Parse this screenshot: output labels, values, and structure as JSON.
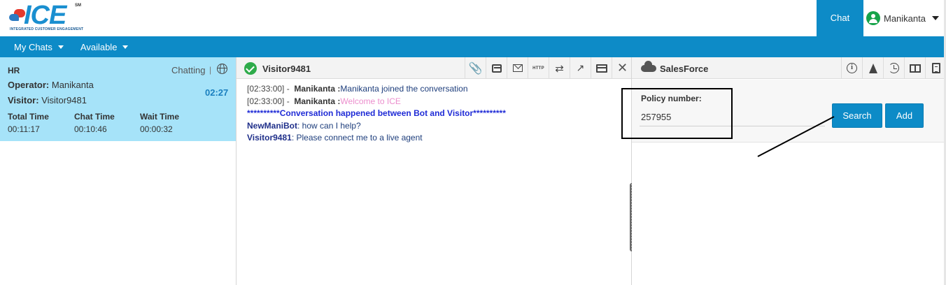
{
  "brand": {
    "logo_text": "ICE",
    "logo_sm": "SM",
    "tagline": "INTEGRATED CUSTOMER ENGAGEMENT"
  },
  "header": {
    "chat_tab": "Chat",
    "user_name": "Manikanta"
  },
  "nav": {
    "items": [
      {
        "label": "My Chats"
      },
      {
        "label": "Available"
      }
    ]
  },
  "chat_card": {
    "queue": "HR",
    "status": "Chatting",
    "separator": "|",
    "operator_label": "Operator:",
    "operator": "Manikanta",
    "visitor_label": "Visitor:",
    "visitor": "Visitor9481",
    "timer": "02:27",
    "stats": [
      {
        "label": "Total Time",
        "value": "00:11:17"
      },
      {
        "label": "Chat Time",
        "value": "00:10:46"
      },
      {
        "label": "Wait Time",
        "value": "00:00:32"
      }
    ]
  },
  "conversation": {
    "title": "Visitor9481",
    "toolbar": {
      "http_label": "HTTP",
      "close_glyph": "✕"
    },
    "lines": [
      {
        "time": "[02:33:00] -",
        "sender": "Manikanta :",
        "text": "Manikanta joined the conversation"
      },
      {
        "time": "[02:33:00] -",
        "sender": "Manikanta :",
        "text": "Welcome to ICE"
      },
      {
        "banner": "**********Conversation happened between Bot and Visitor**********"
      },
      {
        "sender": "NewManiBot",
        "text": ": how can I help?"
      },
      {
        "sender": "Visitor9481",
        "text": ": Please connect me to a live agent"
      }
    ]
  },
  "salesforce": {
    "title": "SalesForce",
    "info_glyph": "i",
    "policy_label": "Policy number:",
    "policy_value": "257955",
    "search_label": "Search",
    "add_label": "Add"
  },
  "colors": {
    "brand_blue": "#0d8bc7",
    "card_bg": "#a6e3f9",
    "online_green": "#17a34a",
    "welcome_pink": "#ec8ecd",
    "banner_blue": "#1f2bd6"
  }
}
